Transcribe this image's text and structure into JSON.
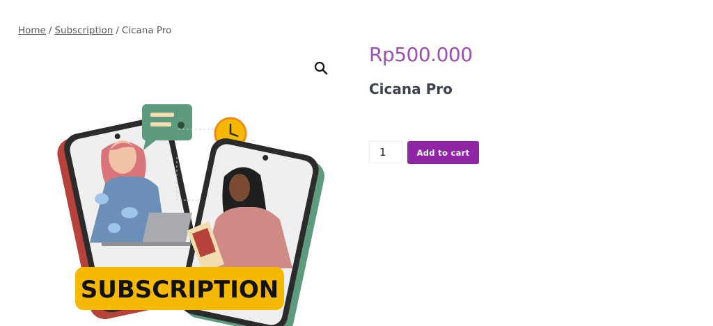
{
  "breadcrumb": {
    "home": "Home",
    "separator": "/",
    "subscription": "Subscription",
    "current": "Cicana Pro"
  },
  "product": {
    "price": "Rp500.000",
    "title": "Cicana Pro",
    "quantity": "1",
    "add_to_cart": "Add to cart",
    "image_banner_text": "SUBSCRIPTION"
  },
  "icons": {
    "zoom": "magnifier-icon"
  },
  "colors": {
    "price": "#9b4fb4",
    "button": "#8e26a6",
    "title": "#3d4250",
    "banner": "#f7b900"
  }
}
